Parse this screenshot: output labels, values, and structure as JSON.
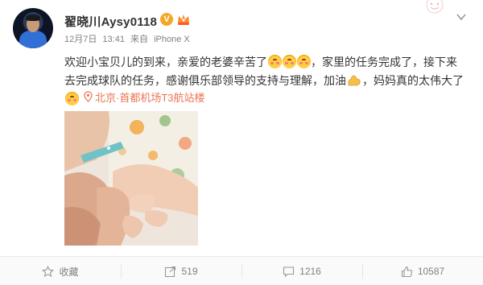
{
  "post": {
    "user": {
      "name": "翟晓川Aysy0118",
      "verified_badge": "V"
    },
    "meta": {
      "date": "12月7日",
      "time": "13:41",
      "source_prefix": "来自",
      "source": "iPhone X"
    },
    "content": {
      "line1_a": "欢迎小宝贝儿的到来，亲爱的老婆辛苦了",
      "line1_b": "，家里的任务完成了，接下来",
      "line2_a": "去完成球队的任务，感谢俱乐部领导的支持与理解，加油",
      "line2_b": "，妈妈真的太伟大了"
    },
    "location": "北京·首都机场T3航站楼",
    "icons": {
      "menu": "chevron-down-icon",
      "location": "location-pin-icon",
      "emoji": "blush-emoji-icon",
      "strong": "flexed-arm-emoji-icon"
    }
  },
  "actions": {
    "favorite_label": "收藏",
    "repost_count": "519",
    "comment_count": "1216",
    "like_count": "10587"
  },
  "colors": {
    "location": "#eb7350",
    "verified": "#f6a623",
    "muted": "#808080"
  }
}
